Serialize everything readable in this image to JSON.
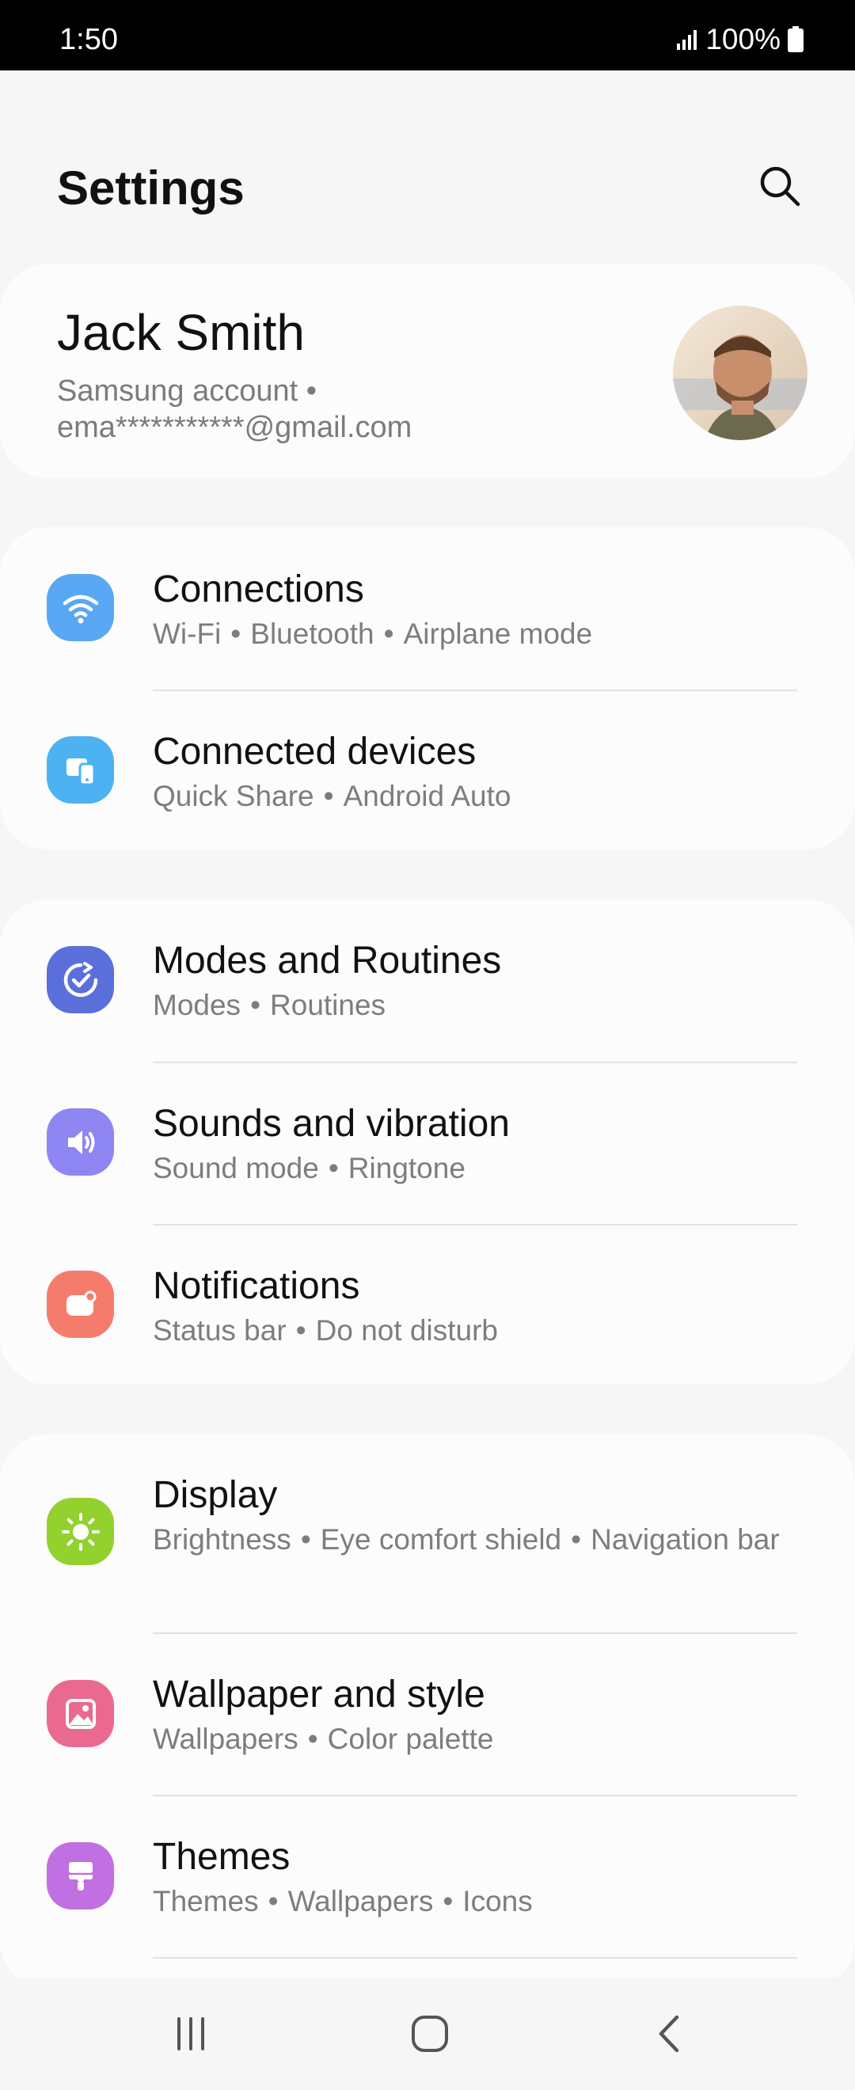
{
  "status_bar": {
    "time": "1:50",
    "battery_text": "100%",
    "icons": [
      "signal-icon",
      "battery-icon"
    ]
  },
  "header": {
    "title": "Settings",
    "search_icon": "search-icon"
  },
  "account": {
    "name": "Jack Smith",
    "line1": "Samsung account  •",
    "line2": "ema***********@gmail.com"
  },
  "groups": [
    {
      "items": [
        {
          "title": "Connections",
          "subtitle": [
            "Wi-Fi",
            "Bluetooth",
            "Airplane mode"
          ],
          "icon": "wifi-icon",
          "color": "#5aa7f3"
        },
        {
          "title": "Connected devices",
          "subtitle": [
            "Quick Share",
            "Android Auto"
          ],
          "icon": "devices-icon",
          "color": "#4cb2f2"
        }
      ]
    },
    {
      "items": [
        {
          "title": "Modes and Routines",
          "subtitle": [
            "Modes",
            "Routines"
          ],
          "icon": "routine-check-icon",
          "color": "#5b6fdb"
        },
        {
          "title": "Sounds and vibration",
          "subtitle": [
            "Sound mode",
            "Ringtone"
          ],
          "icon": "speaker-icon",
          "color": "#8e86f3"
        },
        {
          "title": "Notifications",
          "subtitle": [
            "Status bar",
            "Do not disturb"
          ],
          "icon": "notification-icon",
          "color": "#f57c6c"
        }
      ]
    },
    {
      "items": [
        {
          "title": "Display",
          "subtitle": [
            "Brightness",
            "Eye comfort shield",
            "Navigation bar"
          ],
          "icon": "sun-icon",
          "color": "#93d12e"
        },
        {
          "title": "Wallpaper and style",
          "subtitle": [
            "Wallpapers",
            "Color palette"
          ],
          "icon": "image-icon",
          "color": "#ea6a8f"
        },
        {
          "title": "Themes",
          "subtitle": [
            "Themes",
            "Wallpapers",
            "Icons"
          ],
          "icon": "paint-brush-icon",
          "color": "#c070e0"
        }
      ]
    }
  ],
  "nav": {
    "recents_icon": "recents-icon",
    "home_icon": "home-icon",
    "back_icon": "back-icon"
  }
}
